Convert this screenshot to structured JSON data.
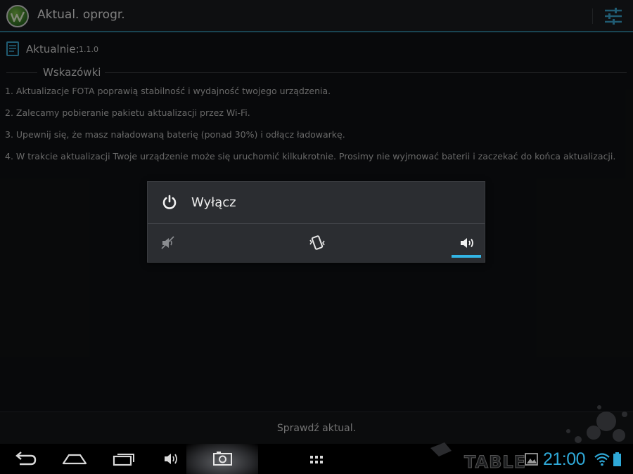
{
  "header": {
    "title": "Aktual. oprogr."
  },
  "current": {
    "label": "Aktualnie:",
    "value": "1.1.0"
  },
  "tips": {
    "title": "Wskazówki",
    "items": [
      "1. Aktualizacje FOTA poprawią stabilność i wydajność twojego urządzenia.",
      "2. Zalecamy pobieranie pakietu aktualizacji przez Wi-Fi.",
      "3. Upewnij się, że masz naładowaną baterię (ponad 30%) i odłącz ładowarkę.",
      "4. W trakcie aktualizacji Twoje urządzenie może się uruchomić kilkukrotnie. Prosimy nie wyjmować baterii i zaczekać do końca aktualizacji."
    ]
  },
  "bottom": {
    "check_label": "Sprawdź aktual."
  },
  "dialog": {
    "power_label": "Wyłącz",
    "modes": [
      "silent",
      "vibrate",
      "sound"
    ],
    "selected_mode": "sound"
  },
  "statusbar": {
    "time": "21:00"
  },
  "watermark": {
    "text": "TABLE"
  },
  "colors": {
    "accent": "#33b5e5",
    "clock": "#2fa9d8",
    "background": "#101214",
    "action_bar": "#1b1d20",
    "dialog": "#2b2d31"
  },
  "icons": {
    "app": "app-logo-icon",
    "settings": "sliders-icon",
    "current": "document-icon",
    "power": "power-icon",
    "silent": "volume-muted-icon",
    "vibrate": "vibrate-icon",
    "sound": "volume-icon",
    "back": "back-icon",
    "home": "home-icon",
    "recents": "recents-icon",
    "volume": "volume-icon",
    "screenshot": "camera-icon",
    "apps": "apps-grid-icon",
    "gallery": "gallery-icon",
    "wifi": "wifi-icon",
    "battery": "battery-icon"
  }
}
